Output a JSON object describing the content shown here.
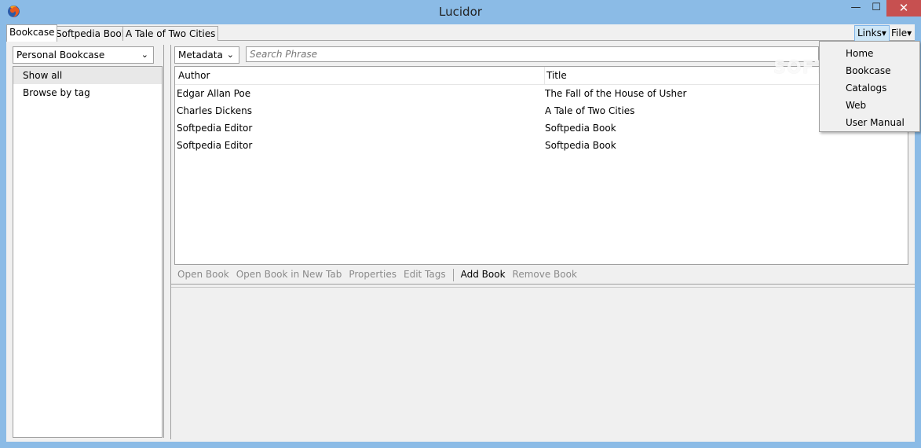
{
  "window": {
    "title": "Lucidor",
    "minimize": "—",
    "maximize": "☐",
    "close": "✕"
  },
  "tabs": [
    {
      "label": "Bookcase"
    },
    {
      "label": "Softpedia Book"
    },
    {
      "label": "A Tale of Two Cities"
    }
  ],
  "toolbar": {
    "links_label": "Links▾",
    "file_label": "File▾"
  },
  "sidebar": {
    "bookcase_select": "Personal Bookcase",
    "items": [
      {
        "label": "Show all"
      },
      {
        "label": "Browse by tag"
      }
    ]
  },
  "search": {
    "field_select": "Metadata",
    "placeholder": "Search Phrase"
  },
  "table": {
    "columns": [
      "Author",
      "Title"
    ],
    "rows": [
      {
        "author": "Edgar Allan Poe",
        "title": "The Fall of the House of Usher"
      },
      {
        "author": "Charles Dickens",
        "title": "A Tale of Two Cities"
      },
      {
        "author": "Softpedia Editor",
        "title": "Softpedia Book"
      },
      {
        "author": "Softpedia Editor",
        "title": "Softpedia Book"
      }
    ]
  },
  "actions": {
    "open_book": "Open Book",
    "open_new_tab": "Open Book in New Tab",
    "properties": "Properties",
    "edit_tags": "Edit Tags",
    "add_book": "Add Book",
    "remove_book": "Remove Book"
  },
  "links_menu": {
    "items": [
      {
        "label": "Home"
      },
      {
        "label": "Bookcase"
      },
      {
        "label": "Catalogs"
      },
      {
        "label": "Web"
      },
      {
        "label": "User Manual"
      }
    ]
  },
  "watermark": "SOFTPEDIA"
}
